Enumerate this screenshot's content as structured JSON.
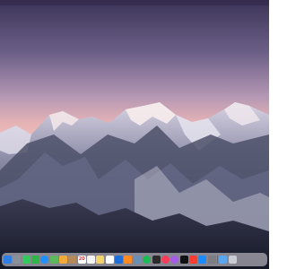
{
  "desktop": {
    "wallpaper": "snowy-mountains-dusk"
  },
  "dock": {
    "apps": [
      {
        "name": "finder-icon",
        "color": "#2f7fe5"
      },
      {
        "name": "launchpad-icon",
        "color": "#8a8f99"
      },
      {
        "name": "messages-icon",
        "color": "#34c759"
      },
      {
        "name": "facetime-icon",
        "color": "#30b44a"
      },
      {
        "name": "safari-icon",
        "color": "#1e90ff"
      },
      {
        "name": "maps-icon",
        "color": "#5cb85c"
      },
      {
        "name": "photos-icon",
        "color": "#f2a93b"
      },
      {
        "name": "contacts-icon",
        "color": "#b48a5a"
      },
      {
        "name": "calendar-icon",
        "color": "#ffffff",
        "text": "20"
      },
      {
        "name": "reminders-icon",
        "color": "#f4f4f4"
      },
      {
        "name": "notes-icon",
        "color": "#f5d36b"
      },
      {
        "name": "freeform-icon",
        "color": "#ffffff"
      },
      {
        "name": "xcode-icon",
        "color": "#1e6fd9"
      },
      {
        "name": "books-icon",
        "color": "#ff8a1f"
      },
      {
        "name": "preview-icon",
        "color": "#6a8fb0"
      },
      {
        "name": "spotify-icon",
        "color": "#1db954"
      },
      {
        "name": "terminal-icon",
        "color": "#2b2b2b"
      },
      {
        "name": "music-icon",
        "color": "#fa3b5a"
      },
      {
        "name": "podcasts-icon",
        "color": "#a55ce6"
      },
      {
        "name": "tv-icon",
        "color": "#111111"
      },
      {
        "name": "news-icon",
        "color": "#ff3b30"
      },
      {
        "name": "app-store-icon",
        "color": "#1a8cff"
      },
      {
        "name": "system-settings-icon",
        "color": "#7d7d82"
      },
      {
        "name": "downloads-folder-icon",
        "color": "#5aa7f0"
      },
      {
        "name": "trash-icon",
        "color": "#c9ccd2"
      }
    ]
  }
}
